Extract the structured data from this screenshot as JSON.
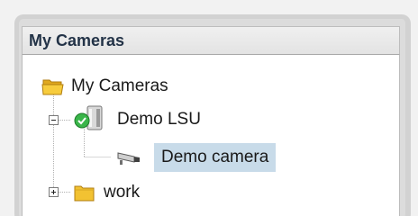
{
  "panel": {
    "title": "My Cameras"
  },
  "tree": {
    "root": {
      "label": "My Cameras",
      "icon": "folder-open-icon"
    },
    "items": [
      {
        "label": "Demo LSU",
        "icon": "server-online-icon",
        "expander": "collapse",
        "status": "online"
      },
      {
        "label": "Demo camera",
        "icon": "camera-icon",
        "selected": true
      },
      {
        "label": "work",
        "icon": "folder-icon",
        "expander": "expand"
      }
    ]
  },
  "colors": {
    "selection": "#c8dbe9",
    "folder": "#f2c232",
    "status_ok": "#3ab54a",
    "title_text": "#233347"
  }
}
